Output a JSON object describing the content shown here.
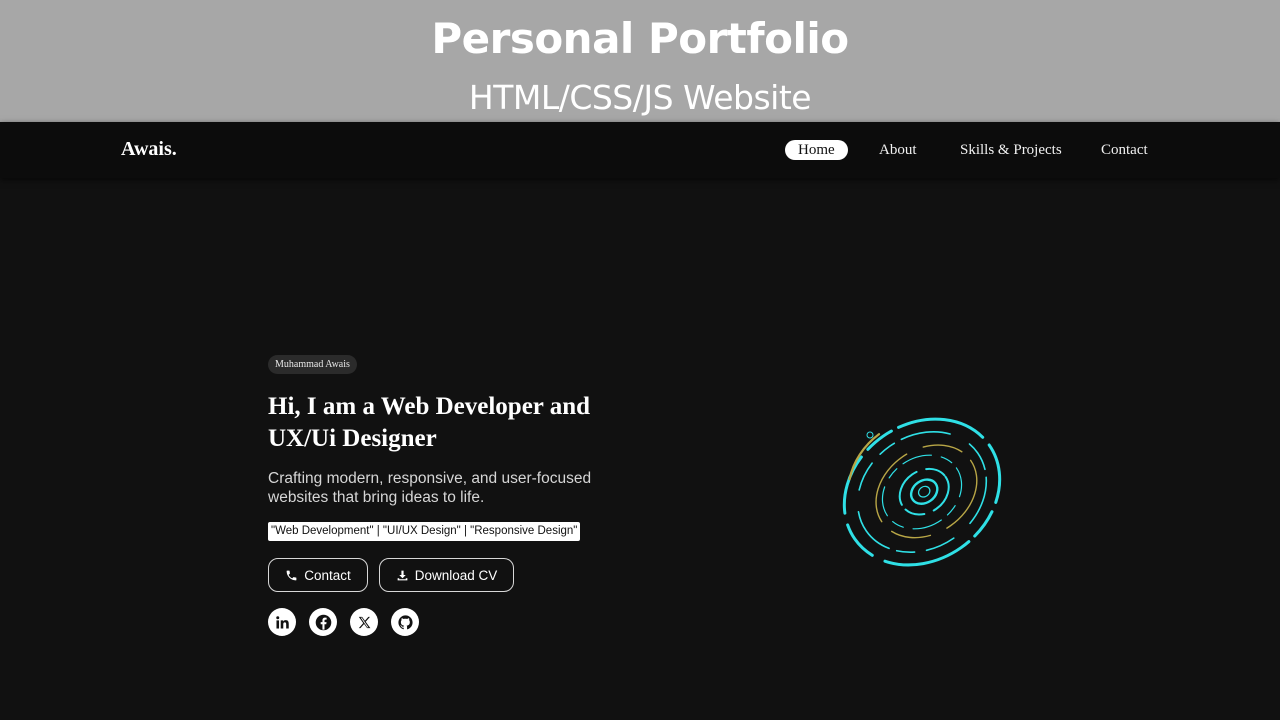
{
  "banner": {
    "title": "Personal Portfolio",
    "subtitle": "HTML/CSS/JS Website"
  },
  "nav": {
    "logo": "Awais.",
    "items": [
      {
        "label": "Home",
        "active": true
      },
      {
        "label": "About"
      },
      {
        "label": "Skills & Projects"
      },
      {
        "label": "Contact"
      }
    ]
  },
  "hero": {
    "badge": "Muhammad Awais",
    "headline": "Hi, I am a Web Developer and UX/Ui Designer",
    "tagline": "Crafting modern, responsive, and user-focused websites that bring ideas to life.",
    "roles": "\"Web Development\" | \"UI/UX Design\" | \"Responsive Design\"",
    "buttons": {
      "contact": {
        "label": "Contact",
        "icon": "phone-icon"
      },
      "download": {
        "label": "Download CV",
        "icon": "download-icon"
      }
    },
    "socials": [
      "linkedin-icon",
      "facebook-icon",
      "x-icon",
      "github-icon"
    ]
  },
  "colors": {
    "background": "#111111",
    "banner": "#a7a7a7",
    "navbar": "#0c0c0c",
    "orb_cyan": "#2fe0e6",
    "orb_gold": "#b8a646"
  }
}
